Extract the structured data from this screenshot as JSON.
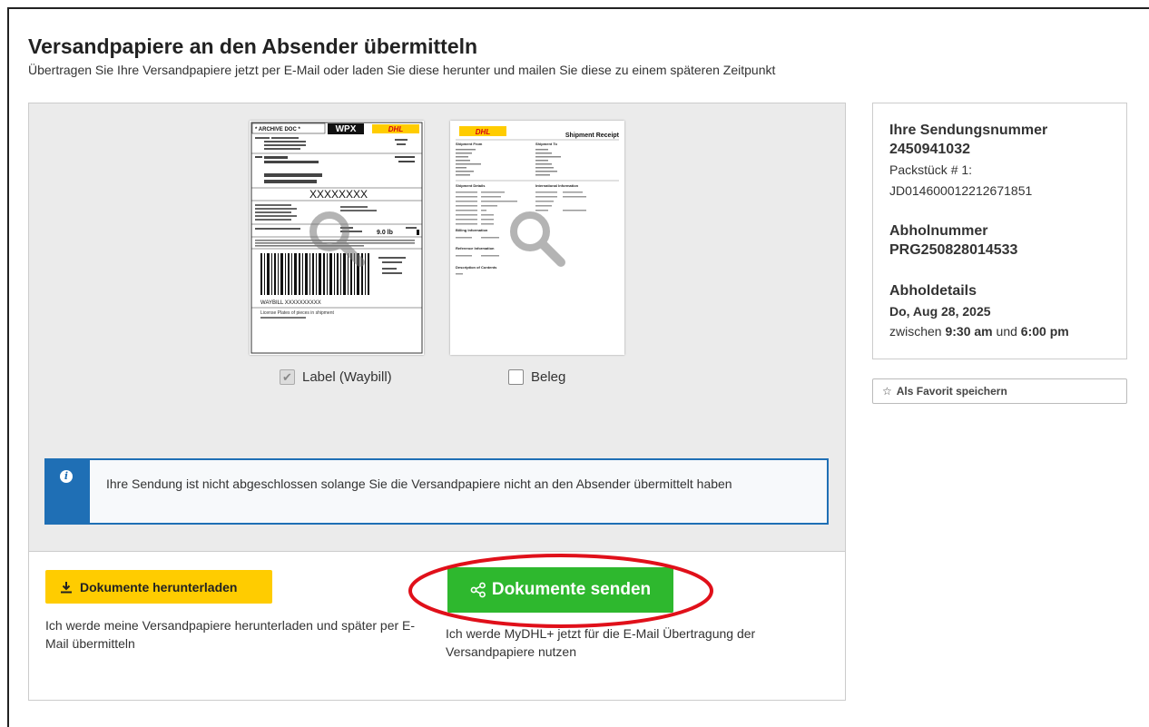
{
  "page": {
    "title": "Versandpapiere an den Absender übermitteln",
    "subtitle": "Übertragen Sie Ihre Versandpapiere jetzt per E-Mail oder laden Sie diese herunter und mailen Sie diese zu einem späteren Zeitpunkt"
  },
  "documents": [
    {
      "checkbox_label": "Label (Waybill)",
      "checked": true,
      "preview": {
        "archive": "* ARCHIVE DOC *",
        "product": "WPX",
        "brand": "DHL",
        "big_code": "XXXXXXXX",
        "waybill": "WAYBILL  XXXXXXXXXX",
        "plates": "License Plates of pieces in shipment",
        "weight": "9.0 lb"
      }
    },
    {
      "checkbox_label": "Beleg",
      "checked": false,
      "preview": {
        "brand": "DHL",
        "heading": "Shipment Receipt",
        "from": "Shipment From",
        "to": "Shipment To",
        "details": "Shipment Details",
        "intl": "International Information",
        "billing": "Billing Information",
        "reference": "Reference Information",
        "contents": "Description of Contents"
      }
    }
  ],
  "info_message": "Ihre Sendung ist nicht abgeschlossen solange Sie die Versandpapiere nicht an den Absender übermittelt haben",
  "download": {
    "button_label": "Dokumente herunterladen",
    "description": "Ich werde meine Versandpapiere herunterladen und später per E-Mail übermitteln"
  },
  "send": {
    "button_label": "Dokumente senden",
    "description": "Ich werde MyDHL+ jetzt für die E-Mail Übertragung der Versandpapiere nutzen"
  },
  "shipment": {
    "number_heading": "Ihre Sendungsnummer",
    "number": "2450941032",
    "package_label": "Packstück # 1:",
    "package_id": "JD014600012212671851",
    "pickup_heading": "Abholnummer",
    "pickup_number": "PRG250828014533",
    "details_heading": "Abholdetails",
    "date": "Do, Aug 28, 2025",
    "between": "zwischen",
    "time_from": "9:30 am",
    "and": "und",
    "time_to": "6:00 pm"
  },
  "favorite": {
    "label": "Als Favorit speichern"
  },
  "colors": {
    "download_button": "#ffcc00",
    "send_button": "#2eb82e",
    "info_accent": "#1f6fb5",
    "annotation": "#e0101a"
  }
}
